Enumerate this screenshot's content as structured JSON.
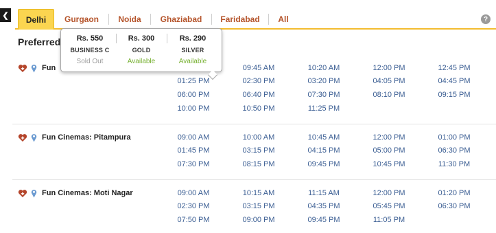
{
  "tabs": [
    {
      "label": "Delhi",
      "active": true
    },
    {
      "label": "Gurgaon",
      "active": false
    },
    {
      "label": "Noida",
      "active": false
    },
    {
      "label": "Ghaziabad",
      "active": false
    },
    {
      "label": "Faridabad",
      "active": false
    },
    {
      "label": "All",
      "active": false
    }
  ],
  "help_icon": "?",
  "section_title": "Preferred",
  "tooltip": {
    "classes": [
      {
        "price": "Rs. 550",
        "name": "BUSINESS C",
        "status": "Sold Out",
        "available": false
      },
      {
        "price": "Rs. 300",
        "name": "GOLD",
        "status": "Available",
        "available": true
      },
      {
        "price": "Rs. 290",
        "name": "SILVER",
        "status": "Available",
        "available": true
      }
    ]
  },
  "cinemas": [
    {
      "name": "Fun",
      "times": [
        "09:45 AM",
        "10:20 AM",
        "12:00 PM",
        "12:45 PM",
        "01:25 PM",
        "02:30 PM",
        "03:20 PM",
        "04:05 PM",
        "04:45 PM",
        "06:00 PM",
        "06:40 PM",
        "07:30 PM",
        "08:10 PM",
        "09:15 PM",
        "10:00 PM",
        "10:50 PM",
        "11:25 PM"
      ]
    },
    {
      "name": "Fun Cinemas: Pitampura",
      "times": [
        "09:00 AM",
        "10:00 AM",
        "10:45 AM",
        "12:00 PM",
        "01:00 PM",
        "01:45 PM",
        "03:15 PM",
        "04:15 PM",
        "05:00 PM",
        "06:30 PM",
        "07:30 PM",
        "08:15 PM",
        "09:45 PM",
        "10:45 PM",
        "11:30 PM"
      ]
    },
    {
      "name": "Fun Cinemas: Moti Nagar",
      "times": [
        "09:00 AM",
        "10:15 AM",
        "11:15 AM",
        "12:00 PM",
        "01:20 PM",
        "02:30 PM",
        "03:15 PM",
        "04:35 PM",
        "05:45 PM",
        "06:30 PM",
        "07:50 PM",
        "09:00 PM",
        "09:45 PM",
        "11:05 PM"
      ]
    }
  ],
  "colors": {
    "tab_active_bg": "#fbd550",
    "tab_text": "#b5542b",
    "time_link": "#3b5e93",
    "available": "#76b030",
    "sold_out": "#9e9e9e",
    "heart_icon": "#b4452b",
    "pin_icon": "#6c9bd1"
  }
}
